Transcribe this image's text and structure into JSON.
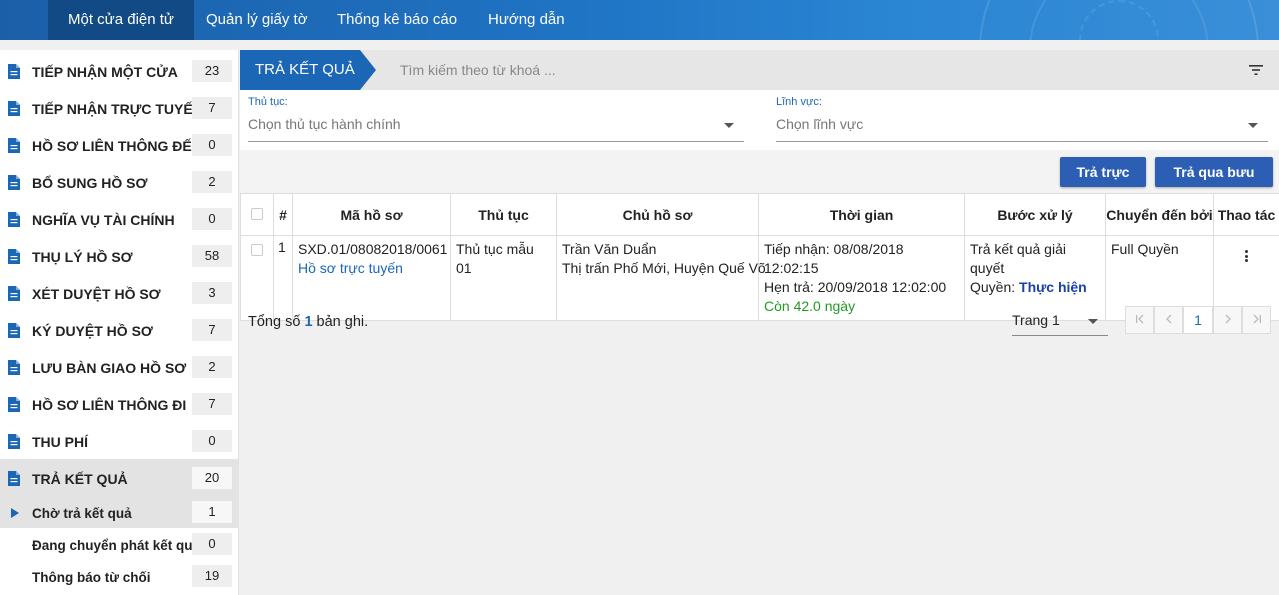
{
  "topnav": {
    "items": [
      {
        "label": "Một cửa điện tử",
        "active": true
      },
      {
        "label": "Quản lý giấy tờ",
        "active": false
      },
      {
        "label": "Thống kê báo cáo",
        "active": false
      },
      {
        "label": "Hướng dẫn",
        "active": false
      }
    ]
  },
  "sidebar": {
    "items": [
      {
        "label": "TIẾP NHẬN MỘT CỬA",
        "count": "23",
        "icon": "document-icon"
      },
      {
        "label": "TIẾP NHẬN TRỰC TUYẾN",
        "count": "7",
        "icon": "document-icon"
      },
      {
        "label": "HỒ SƠ LIÊN THÔNG ĐẾN",
        "count": "0",
        "icon": "document-icon"
      },
      {
        "label": "BỔ SUNG HỒ SƠ",
        "count": "2",
        "icon": "document-icon"
      },
      {
        "label": "NGHĨA VỤ TÀI CHÍNH",
        "count": "0",
        "icon": "document-icon"
      },
      {
        "label": "THỤ LÝ HỒ SƠ",
        "count": "58",
        "icon": "document-icon"
      },
      {
        "label": "XÉT DUYỆT HỒ SƠ",
        "count": "3",
        "icon": "document-icon"
      },
      {
        "label": "KÝ DUYỆT HỒ SƠ",
        "count": "7",
        "icon": "document-icon"
      },
      {
        "label": "LƯU BÀN GIAO HỒ SƠ",
        "count": "2",
        "icon": "document-icon"
      },
      {
        "label": "HỒ SƠ LIÊN THÔNG ĐI",
        "count": "7",
        "icon": "document-icon"
      },
      {
        "label": "THU PHÍ",
        "count": "0",
        "icon": "document-icon"
      },
      {
        "label": "TRẢ KẾT QUẢ",
        "count": "20",
        "icon": "document-icon",
        "active": true
      }
    ],
    "subitems": [
      {
        "label": "Chờ trả kết quả",
        "count": "1",
        "active": true
      },
      {
        "label": "Đang chuyển phát kết quả",
        "count": "0"
      },
      {
        "label": "Thông báo từ chối",
        "count": "19"
      }
    ]
  },
  "toolbar": {
    "section_title": "TRẢ KẾT QUẢ",
    "search_placeholder": "Tìm kiếm theo từ khoá ...",
    "filter_icon": "filter-icon"
  },
  "filters": {
    "procedure": {
      "label": "Thủ tục:",
      "placeholder": "Chọn thủ tục hành chính"
    },
    "field": {
      "label": "Lĩnh vực:",
      "placeholder": "Chọn lĩnh vực"
    }
  },
  "actions": {
    "direct_return": "Trả trực tiếp",
    "postal_return": "Trả qua bưu chính"
  },
  "table": {
    "headers": [
      "#",
      "Mã hồ sơ",
      "Thủ tục",
      "Chủ hồ sơ",
      "Thời gian",
      "Bước xử lý",
      "Chuyển đến bởi",
      "Thao tác"
    ],
    "rows": [
      {
        "index": "1",
        "code": "SXD.01/08082018/0061",
        "code_type": "Hồ sơ trực tuyến",
        "procedure": "Thủ tục mẫu 01",
        "owner_name": "Trần Văn Duẩn",
        "owner_address": "Thị trấn Phố Mới, Huyện Quế Võ",
        "received": "Tiếp nhận: 08/08/2018 12:02:15",
        "due": "Hẹn trả: 20/09/2018 12:02:00",
        "remaining": "Còn 42.0 ngày",
        "step": "Trả kết quả giải quyết",
        "permission_label": "Quyền:",
        "permission_value": "Thực hiện",
        "forwarded_by": "Full Quyền"
      }
    ]
  },
  "footer": {
    "total_prefix": "Tổng số",
    "total_count": "1",
    "total_suffix": "bản ghi.",
    "page_select": "Trang 1",
    "current_page": "1"
  },
  "colors": {
    "primary": "#1b67b5",
    "button": "#2c5fb3",
    "nav_active": "#124a86",
    "remaining_green": "#229a22"
  }
}
